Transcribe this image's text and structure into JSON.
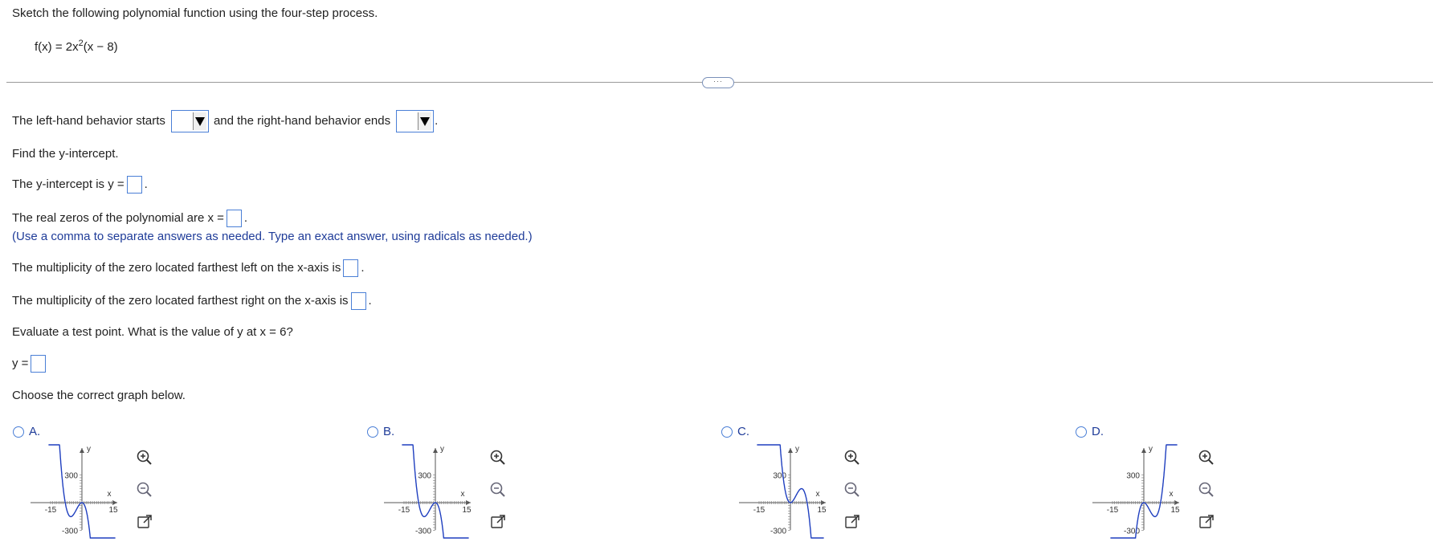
{
  "question": {
    "instruction": "Sketch the following polynomial function using the four-step process.",
    "function_text": "f(x) = 2x",
    "function_exp": "2",
    "function_tail": "(x − 8)"
  },
  "more_button": "···",
  "step_end_behavior": {
    "text_before": "The left-hand behavior starts",
    "text_middle": "and the right-hand behavior ends",
    "text_end": "."
  },
  "step_y_intercept": {
    "prompt": "Find the y-intercept.",
    "text": "The y-intercept is y =",
    "end": "."
  },
  "step_zeros": {
    "text": "The real zeros of the polynomial are x =",
    "end": ".",
    "note": "(Use a comma to separate answers as needed. Type an exact answer, using radicals as needed.)"
  },
  "step_mult_left": {
    "text": "The multiplicity of the zero located farthest left on the x-axis is",
    "end": "."
  },
  "step_mult_right": {
    "text": "The multiplicity of the zero located farthest right on the x-axis is",
    "end": "."
  },
  "step_test": {
    "text": "Evaluate a test point. What is the value of y at x = 6?",
    "answer_label": "y ="
  },
  "choose_text": "Choose the correct graph below.",
  "options": [
    {
      "label": "A."
    },
    {
      "label": "B."
    },
    {
      "label": "C."
    },
    {
      "label": "D."
    }
  ],
  "graph_labels": {
    "y": "y",
    "x": "x",
    "ymax": "300",
    "ymin": "-300",
    "xmin": "-15",
    "xmax": "15"
  },
  "icons": [
    "zoom-in-icon",
    "zoom-out-icon",
    "popout-icon"
  ],
  "colors": {
    "curve": "#1f3fbf",
    "input_border": "#4a7fd6",
    "note": "#1f3c99"
  }
}
